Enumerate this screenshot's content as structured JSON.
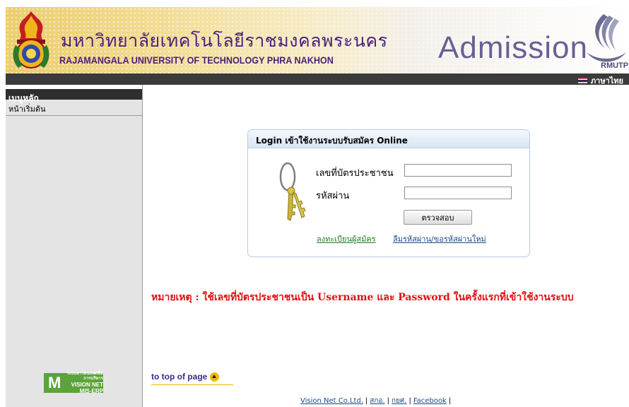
{
  "header": {
    "university_thai": "มหาวิทยาลัยเทคโนโลยีราชมงคลพระนคร",
    "university_eng": "RAJAMANGALA UNIVERSITY OF TECHNOLOGY PHRA NAKHON",
    "admission": "Admission",
    "rmutp": "RMUTP"
  },
  "navbar": {
    "language": "ภาษาไทย"
  },
  "sidebar": {
    "heading": "เมนูหลัก",
    "items": [
      {
        "label": "หน้าเริ่มต้น"
      }
    ],
    "logo": {
      "mark": "M",
      "line1": "ระบบสารสนเทศเพื่อการบริหาร",
      "line2": "VISION NET",
      "line3": "MIS-ERP"
    }
  },
  "login": {
    "title": "Login เข้าใช้งานระบบรับสมัคร Online",
    "id_label": "เลขที่บัตรประชาชน",
    "id_value": "",
    "password_label": "รหัสผ่าน",
    "password_value": "",
    "submit_label": "ตรวจสอบ",
    "register_link": "ลงทะเบียนผู้สมัคร",
    "forgot_link": "ลืมรหัสผ่าน/ขอรหัสผ่านใหม่"
  },
  "note": "หมายเหตุ : ใช้เลขที่บัตรประชาชนเป็น Username และ Password ในครั้งแรกที่เข้าใช้งานระบบ",
  "footer": {
    "to_top": "to top of page",
    "links": [
      "Vision Net Co.Ltd.",
      "สกอ.",
      "กยศ.",
      "Facebook"
    ]
  },
  "colors": {
    "nav_dark": "#3b3b3b",
    "title_purple": "#4a1f7a",
    "note_red": "#e01010",
    "link_green": "#227c1f",
    "link_blue": "#1a4a86"
  }
}
